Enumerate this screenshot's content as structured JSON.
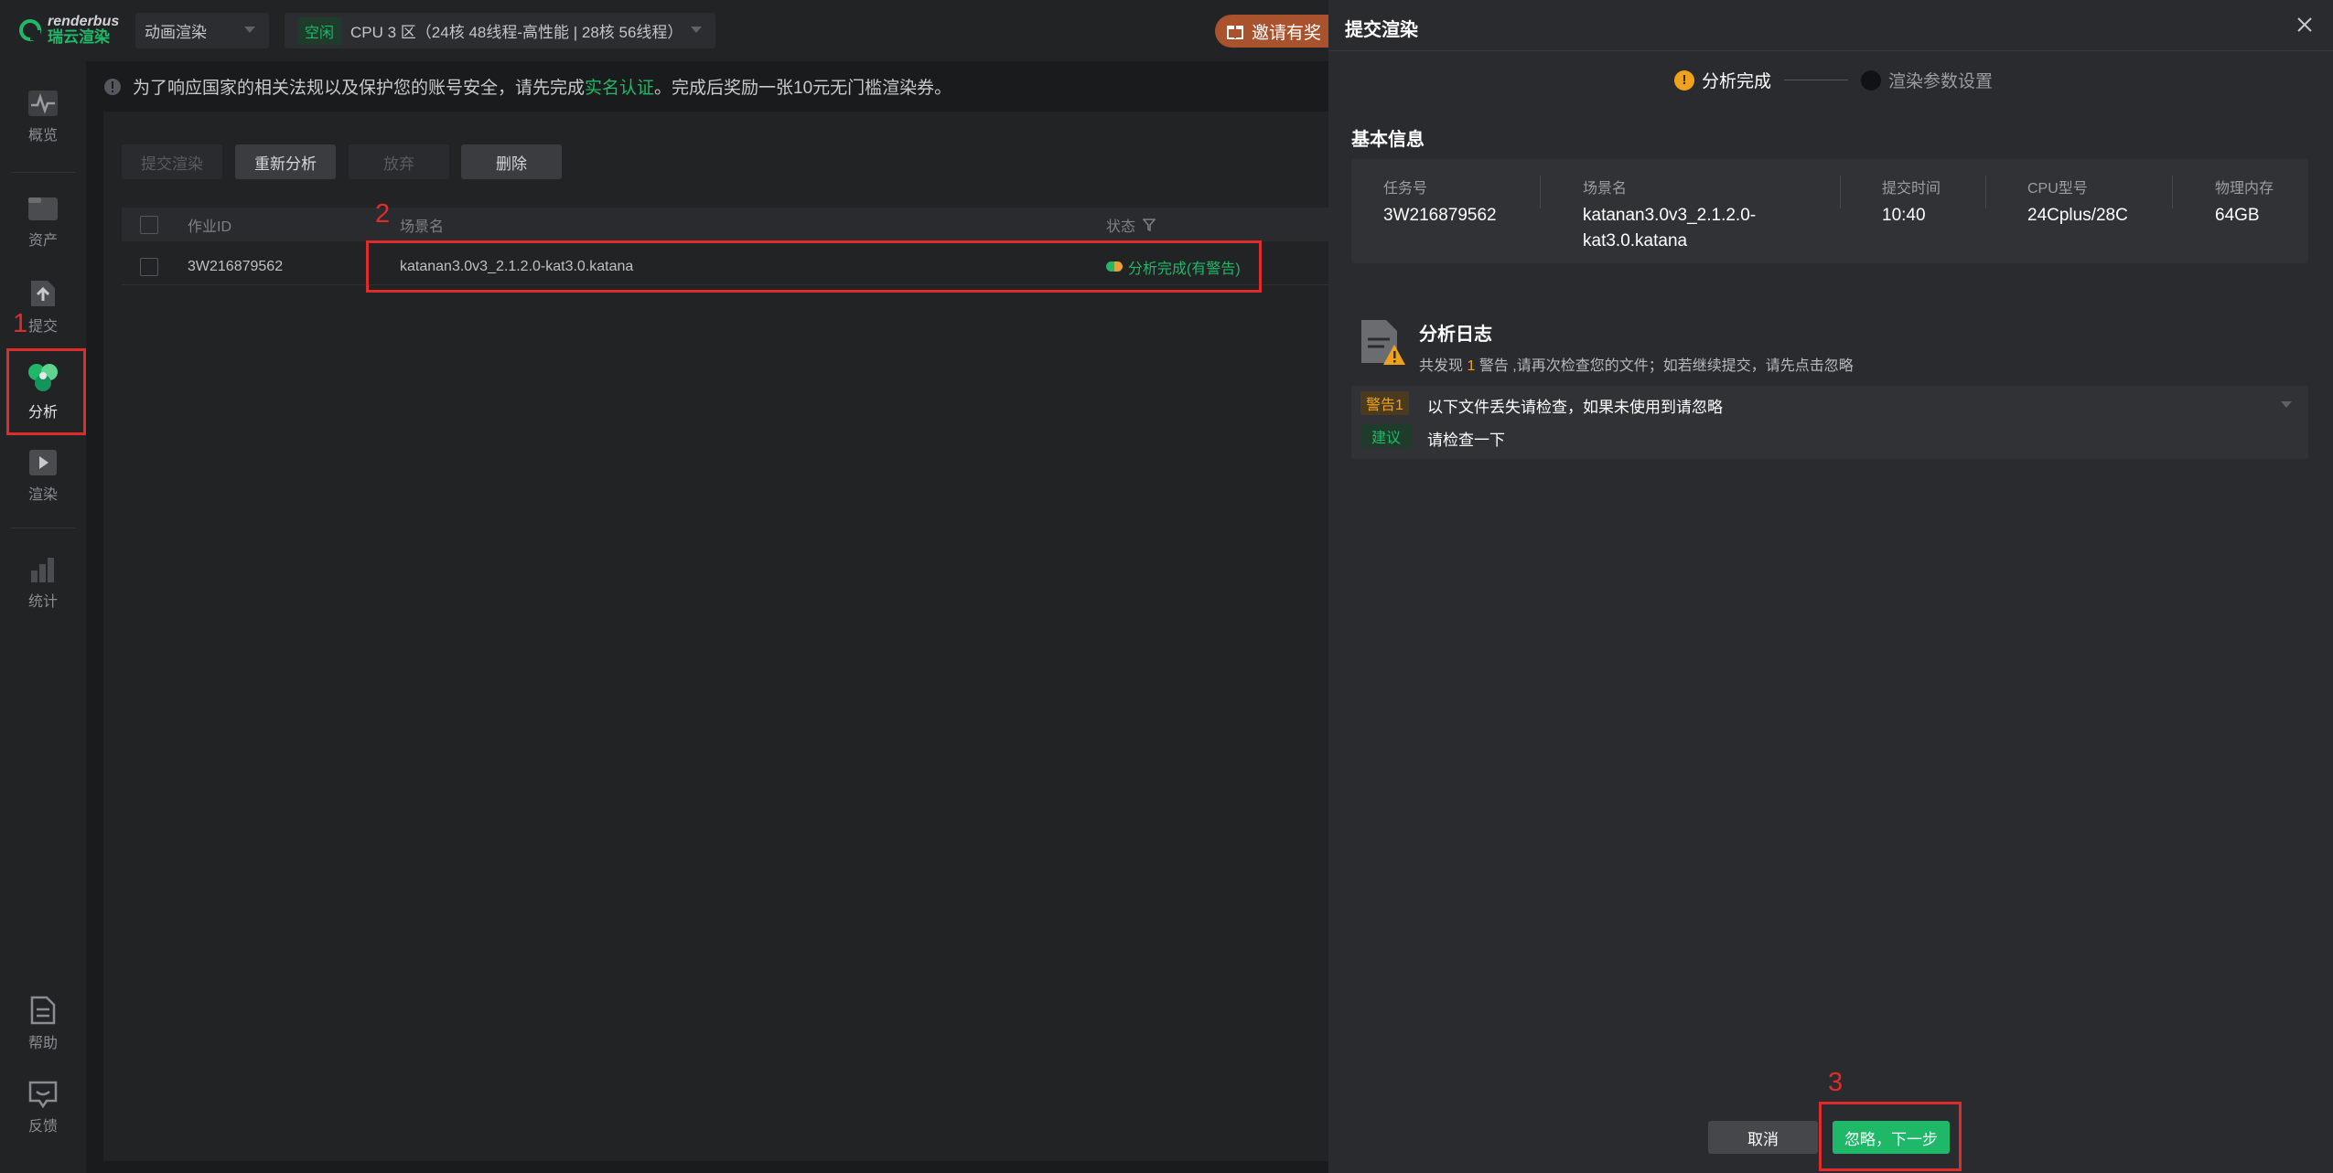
{
  "app": {
    "logo_en": "renderbus",
    "logo_cn": "瑞云渲染",
    "mode_select": "动画渲染",
    "cpu_badge": "空闲",
    "cpu_select": "CPU 3 区（24核 48线程-高性能 | 28核 56线程）",
    "invite_label": "邀请有奖"
  },
  "sidebar": {
    "items": [
      {
        "label": "概览",
        "icon": "overview-icon"
      },
      {
        "label": "资产",
        "icon": "assets-icon"
      },
      {
        "label": "提交",
        "icon": "submit-icon"
      },
      {
        "label": "分析",
        "icon": "analysis-icon"
      },
      {
        "label": "渲染",
        "icon": "render-icon"
      },
      {
        "label": "统计",
        "icon": "stats-icon"
      },
      {
        "label": "帮助",
        "icon": "help-icon"
      },
      {
        "label": "反馈",
        "icon": "feedback-icon"
      }
    ],
    "active": "分析"
  },
  "notice": {
    "text_before": "为了响应国家的相关法规以及保护您的账号安全，请先完成",
    "link": "实名认证",
    "text_after": "。完成后奖励一张10元无门槛渲染券。"
  },
  "toolbar": {
    "submit_render": "提交渲染",
    "reanalyze": "重新分析",
    "abandon": "放弃",
    "delete": "删除"
  },
  "table": {
    "columns": [
      "作业ID",
      "场景名",
      "状态"
    ],
    "rows": [
      {
        "job_id": "3W216879562",
        "scene": "katanan3.0v3_2.1.2.0-kat3.0.katana",
        "status": "分析完成(有警告)"
      }
    ]
  },
  "annotations": {
    "n1": "1",
    "n2": "2",
    "n3": "3"
  },
  "annotation_color": "#e02b2b",
  "drawer": {
    "title": "提交渲染",
    "steps": [
      {
        "label": "分析完成",
        "state": "warning",
        "mark": "!"
      },
      {
        "label": "渲染参数设置",
        "state": "pending"
      }
    ],
    "basic_info_title": "基本信息",
    "info": {
      "task_id_label": "任务号",
      "task_id": "3W216879562",
      "scene_label": "场景名",
      "scene_line1": "katanan3.0v3_2.1.2.0-",
      "scene_line2": "kat3.0.katana",
      "time_label": "提交时间",
      "time": "10:40",
      "cpu_label": "CPU型号",
      "cpu": "24Cplus/28C",
      "mem_label": "物理内存",
      "mem": "64GB"
    },
    "log": {
      "title": "分析日志",
      "desc_before": "共发现",
      "warn_count": "1",
      "desc_after": "警告 ,请再次检查您的文件；如若继续提交，请先点击忽略",
      "warn_tag": "警告1",
      "warn_text": "以下文件丢失请检查，如果未使用到请忽略",
      "suggest_tag": "建议",
      "suggest_text": "请检查一下"
    },
    "cancel": "取消",
    "next": "忽略，下一步"
  },
  "colors": {
    "accent": "#1fb868",
    "warning": "#f0a21b",
    "background": "#1a1b1d",
    "panel": "#2a2b2e"
  }
}
